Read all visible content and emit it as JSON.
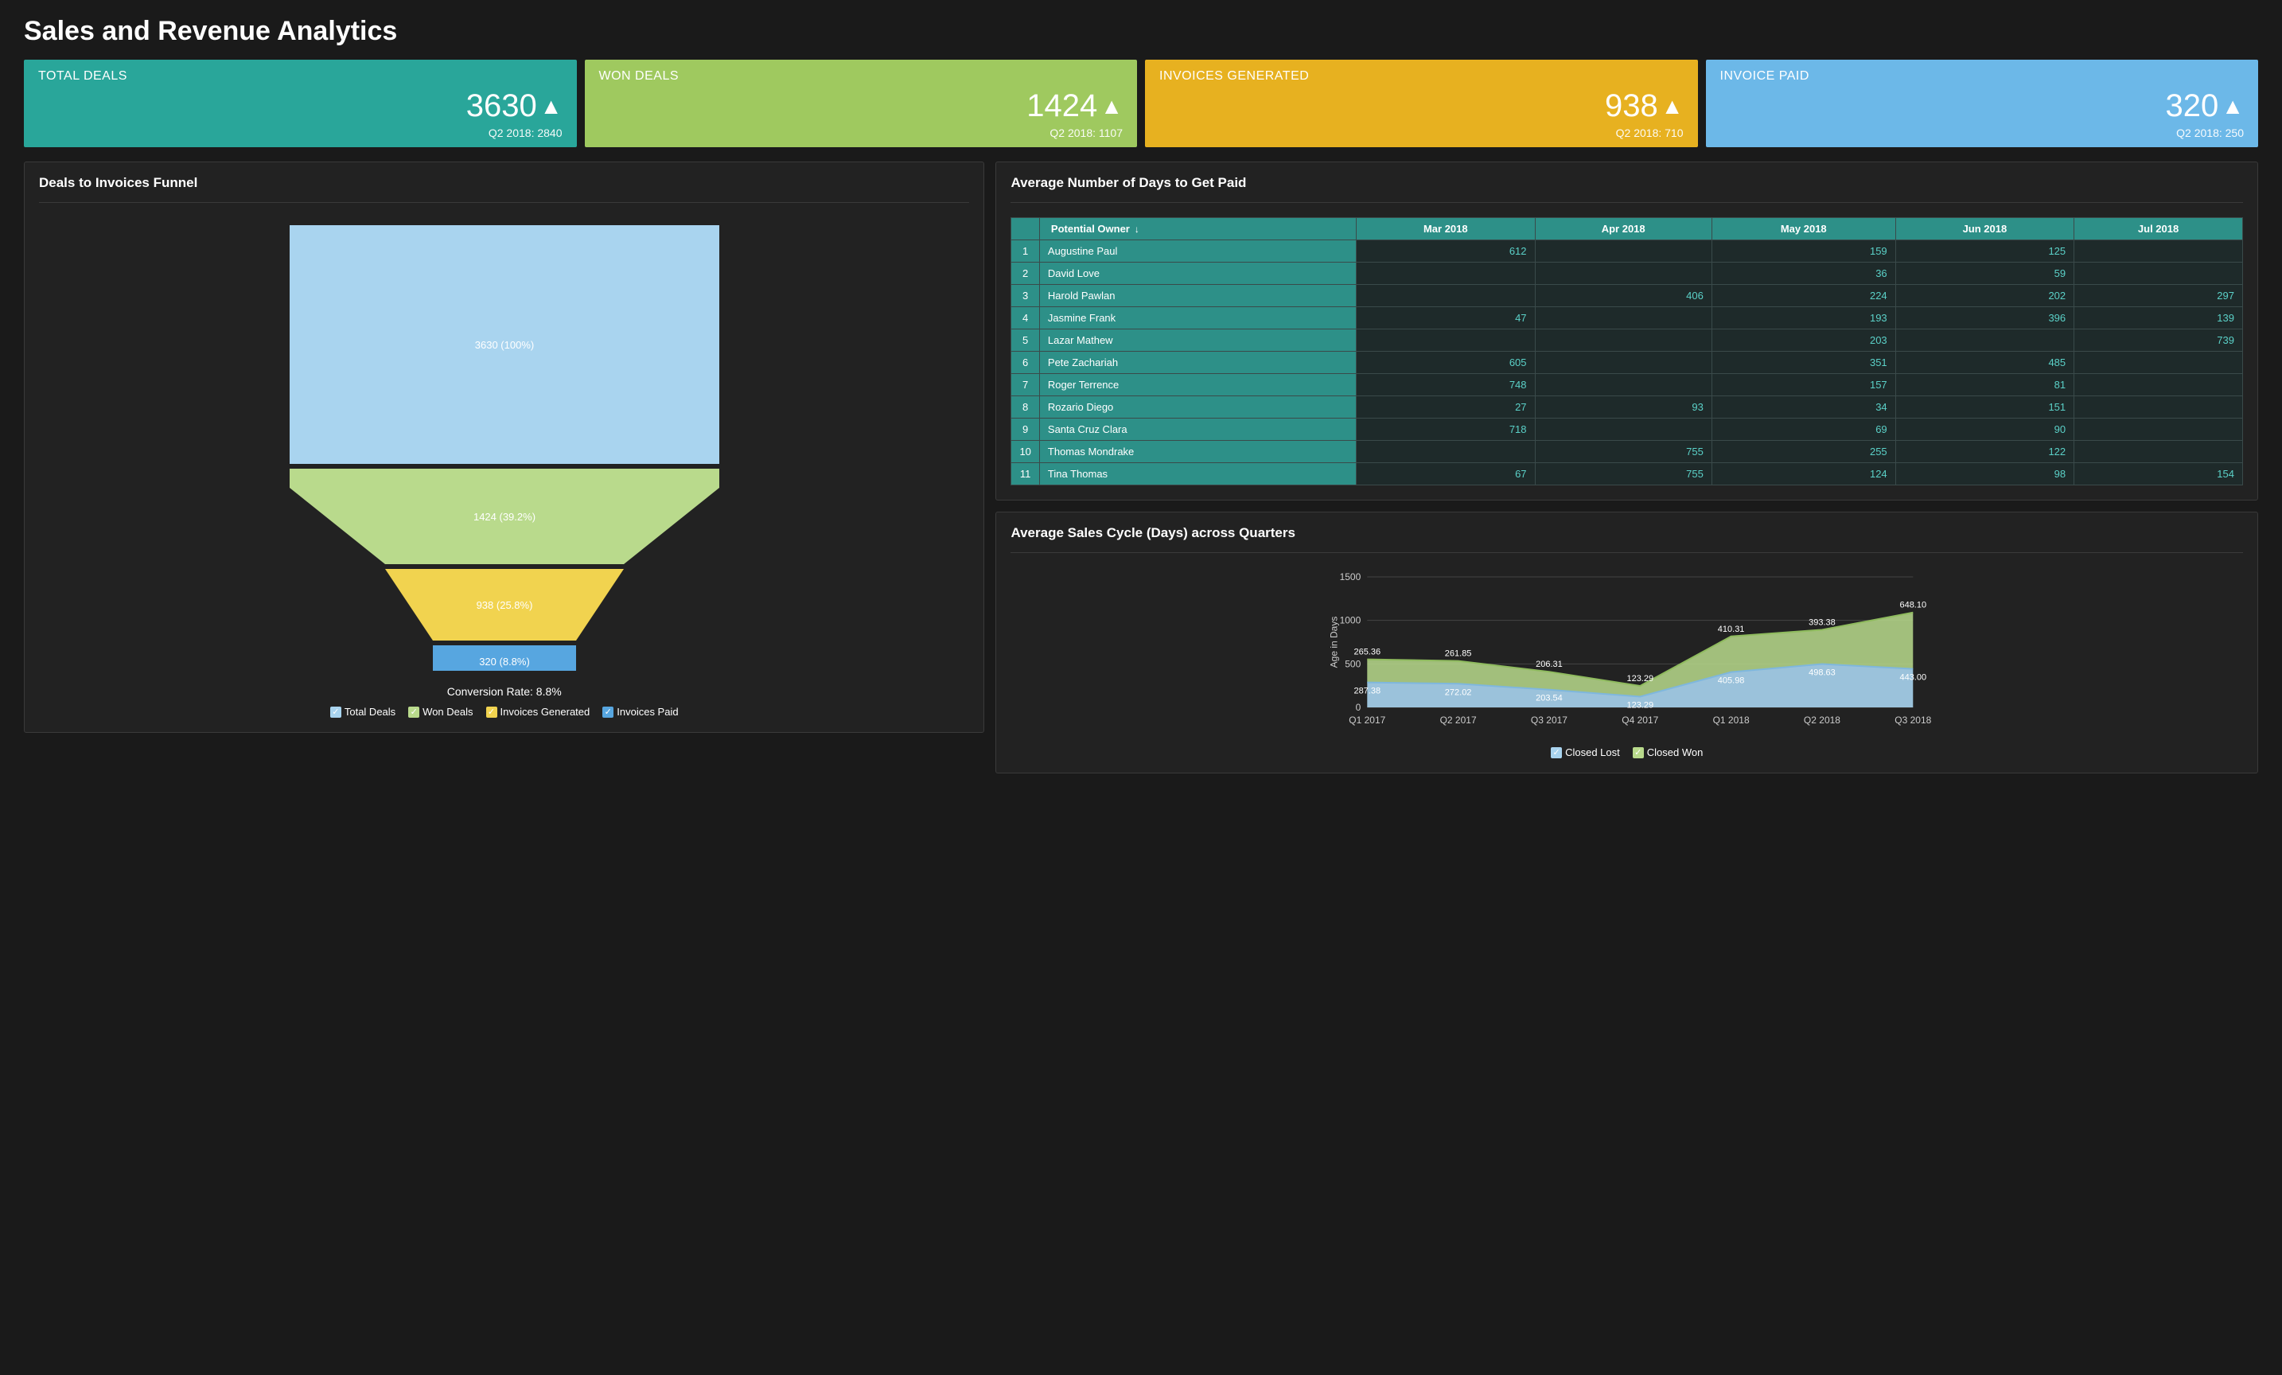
{
  "page": {
    "title": "Sales and Revenue Analytics"
  },
  "kpi": [
    {
      "label": "TOTAL DEALS",
      "value": "3630",
      "sub": "Q2 2018: 2840",
      "arrow": "▲"
    },
    {
      "label": "WON DEALS",
      "value": "1424",
      "sub": "Q2 2018: 1107",
      "arrow": "▲"
    },
    {
      "label": "INVOICES GENERATED",
      "value": "938",
      "sub": "Q2 2018: 710",
      "arrow": "▲"
    },
    {
      "label": "INVOICE PAID",
      "value": "320",
      "sub": "Q2 2018: 250",
      "arrow": "▲"
    }
  ],
  "funnel": {
    "title": "Deals to Invoices Funnel",
    "conversion": "Conversion Rate: 8.8%",
    "legend": [
      {
        "label": "Total Deals",
        "color": "#a9d4ef"
      },
      {
        "label": "Won Deals",
        "color": "#b9da8c"
      },
      {
        "label": "Invoices Generated",
        "color": "#f1d34f"
      },
      {
        "label": "Invoices Paid",
        "color": "#57a6e0"
      }
    ],
    "stages": [
      {
        "label": "3630 (100%)"
      },
      {
        "label": "1424 (39.2%)"
      },
      {
        "label": "938 (25.8%)"
      },
      {
        "label": "320 (8.8%)"
      }
    ]
  },
  "table": {
    "title": "Average Number of Days to Get Paid",
    "headers": [
      "Potential Owner",
      "Mar 2018",
      "Apr 2018",
      "May 2018",
      "Jun 2018",
      "Jul 2018"
    ],
    "sort_icon": "↓",
    "rows": [
      {
        "name": "Augustine Paul",
        "vals": [
          "612",
          "",
          "159",
          "125",
          ""
        ]
      },
      {
        "name": "David Love",
        "vals": [
          "",
          "",
          "36",
          "59",
          ""
        ]
      },
      {
        "name": "Harold Pawlan",
        "vals": [
          "",
          "406",
          "224",
          "202",
          "297"
        ]
      },
      {
        "name": "Jasmine Frank",
        "vals": [
          "47",
          "",
          "193",
          "396",
          "139"
        ]
      },
      {
        "name": "Lazar Mathew",
        "vals": [
          "",
          "",
          "203",
          "",
          "739"
        ]
      },
      {
        "name": "Pete Zachariah",
        "vals": [
          "605",
          "",
          "351",
          "485",
          ""
        ]
      },
      {
        "name": "Roger Terrence",
        "vals": [
          "748",
          "",
          "157",
          "81",
          ""
        ]
      },
      {
        "name": "Rozario Diego",
        "vals": [
          "27",
          "93",
          "34",
          "151",
          ""
        ]
      },
      {
        "name": "Santa Cruz Clara",
        "vals": [
          "718",
          "",
          "69",
          "90",
          ""
        ]
      },
      {
        "name": "Thomas Mondrake",
        "vals": [
          "",
          "755",
          "255",
          "122",
          ""
        ]
      },
      {
        "name": "Tina Thomas",
        "vals": [
          "67",
          "755",
          "124",
          "98",
          "154"
        ]
      }
    ]
  },
  "area": {
    "title": "Average Sales Cycle (Days) across Quarters",
    "ylabel": "Age in Days",
    "legend": [
      {
        "label": "Closed Lost",
        "color": "#a9d4ef"
      },
      {
        "label": "Closed Won",
        "color": "#b9da8c"
      }
    ]
  },
  "chart_data": [
    {
      "type": "funnel",
      "title": "Deals to Invoices Funnel",
      "stages": [
        {
          "name": "Total Deals",
          "value": 3630,
          "pct": 100
        },
        {
          "name": "Won Deals",
          "value": 1424,
          "pct": 39.2
        },
        {
          "name": "Invoices Generated",
          "value": 938,
          "pct": 25.8
        },
        {
          "name": "Invoices Paid",
          "value": 320,
          "pct": 8.8
        }
      ],
      "conversion_rate": 8.8
    },
    {
      "type": "table",
      "title": "Average Number of Days to Get Paid",
      "columns": [
        "Potential Owner",
        "Mar 2018",
        "Apr 2018",
        "May 2018",
        "Jun 2018",
        "Jul 2018"
      ],
      "rows": [
        [
          "Augustine Paul",
          612,
          null,
          159,
          125,
          null
        ],
        [
          "David Love",
          null,
          null,
          36,
          59,
          null
        ],
        [
          "Harold Pawlan",
          null,
          406,
          224,
          202,
          297
        ],
        [
          "Jasmine Frank",
          47,
          null,
          193,
          396,
          139
        ],
        [
          "Lazar Mathew",
          null,
          null,
          203,
          null,
          739
        ],
        [
          "Pete Zachariah",
          605,
          null,
          351,
          485,
          null
        ],
        [
          "Roger Terrence",
          748,
          null,
          157,
          81,
          null
        ],
        [
          "Rozario Diego",
          27,
          93,
          34,
          151,
          null
        ],
        [
          "Santa Cruz Clara",
          718,
          null,
          69,
          90,
          null
        ],
        [
          "Thomas Mondrake",
          null,
          755,
          255,
          122,
          null
        ],
        [
          "Tina Thomas",
          67,
          755,
          124,
          98,
          154
        ]
      ]
    },
    {
      "type": "area",
      "title": "Average Sales Cycle (Days) across Quarters",
      "xlabel": "",
      "ylabel": "Age in Days",
      "ylim": [
        0,
        1500
      ],
      "categories": [
        "Q1 2017",
        "Q2 2017",
        "Q3 2017",
        "Q4 2017",
        "Q1 2018",
        "Q2 2018",
        "Q3 2018"
      ],
      "series": [
        {
          "name": "Closed Lost",
          "values": [
            287.38,
            272.02,
            203.54,
            123.29,
            405.98,
            498.63,
            443.0
          ]
        },
        {
          "name": "Closed Won",
          "values": [
            265.36,
            261.85,
            206.31,
            123.29,
            410.31,
            393.38,
            648.1
          ]
        }
      ],
      "stacked": true
    }
  ]
}
